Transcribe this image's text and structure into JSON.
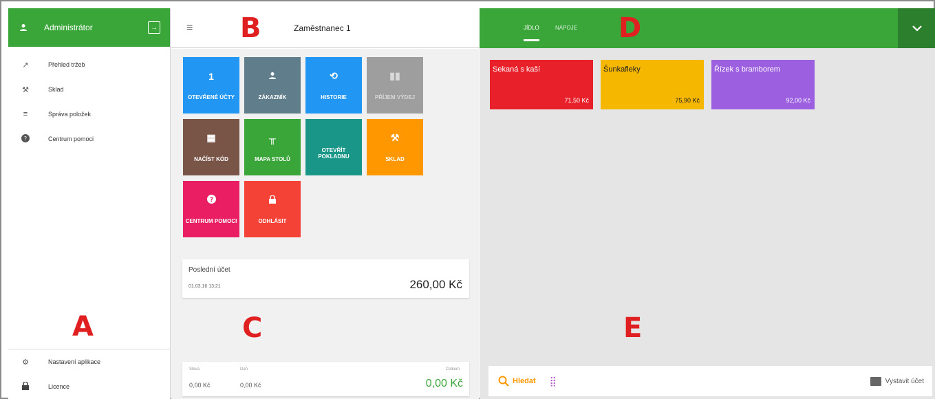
{
  "sidebar": {
    "user": "Administrátor",
    "items": [
      {
        "icon": "trend-icon",
        "label": "Přehled tržeb"
      },
      {
        "icon": "warehouse-icon",
        "label": "Sklad"
      },
      {
        "icon": "list-icon",
        "label": "Správa položek"
      },
      {
        "icon": "help-icon",
        "label": "Centrum pomoci"
      }
    ],
    "bottom": [
      {
        "icon": "gear-icon",
        "label": "Nastavení aplikace"
      },
      {
        "icon": "lock-icon",
        "label": "Licence"
      }
    ]
  },
  "labels": {
    "a": "A",
    "b": "B",
    "c": "C",
    "d": "D",
    "e": "E"
  },
  "topbar": {
    "employee": "Zaměstnanec 1"
  },
  "tiles": [
    {
      "icon": "1",
      "label": "OTEVŘENÉ ÚČTY",
      "color": "#2196f3"
    },
    {
      "icon": "👤",
      "label": "ZÁKAZNÍK",
      "color": "#5f7d8a"
    },
    {
      "icon": "⟲",
      "label": "HISTORIE",
      "color": "#2196f3"
    },
    {
      "icon": "▮▮",
      "label": "PŘÍJEM VÝDEJ",
      "color": "#9e9e9e"
    },
    {
      "icon": "▦",
      "label": "NAČÍST KÓD",
      "color": "#795548"
    },
    {
      "icon": "╥",
      "label": "MAPA STOLŮ",
      "color": "#3aa63a"
    },
    {
      "icon": "",
      "label": "OTEVŘÍT POKLADNU",
      "color": "#1a9688"
    },
    {
      "icon": "⚒",
      "label": "SKLAD",
      "color": "#ff9800"
    },
    {
      "icon": "?",
      "label": "CENTRUM POMOCI",
      "color": "#e91e63"
    },
    {
      "icon": "🔒",
      "label": "ODHLÁSIT",
      "color": "#f44336"
    }
  ],
  "last_bill": {
    "title": "Poslední účet",
    "datetime": "01.03.16 13:21",
    "amount": "260,00 Kč"
  },
  "summary": {
    "discount_label": "Sleva",
    "discount": "0,00 Kč",
    "tax_label": "Daň",
    "tax": "0,00 Kč",
    "total_label": "Celkem",
    "total": "0,00 Kč"
  },
  "tabs": {
    "food": "JÍDLO",
    "drinks": "NÁPOJE"
  },
  "products": [
    {
      "name": "Sekaná s kaší",
      "price": "71,50 Kč",
      "color": "#e8202a"
    },
    {
      "name": "Šunkafleky",
      "price": "75,90 Kč",
      "color": "#f5b700"
    },
    {
      "name": "Řízek s bramborem",
      "price": "92,00 Kč",
      "color": "#9c5fe0"
    }
  ],
  "bottombar": {
    "search": "Hledat",
    "issue_bill": "Vystavit účet"
  },
  "colors": {
    "green": "#3aa63a",
    "dark_green": "#2c7f2c",
    "total_green": "#3aa63a",
    "orange": "#ff9800"
  }
}
